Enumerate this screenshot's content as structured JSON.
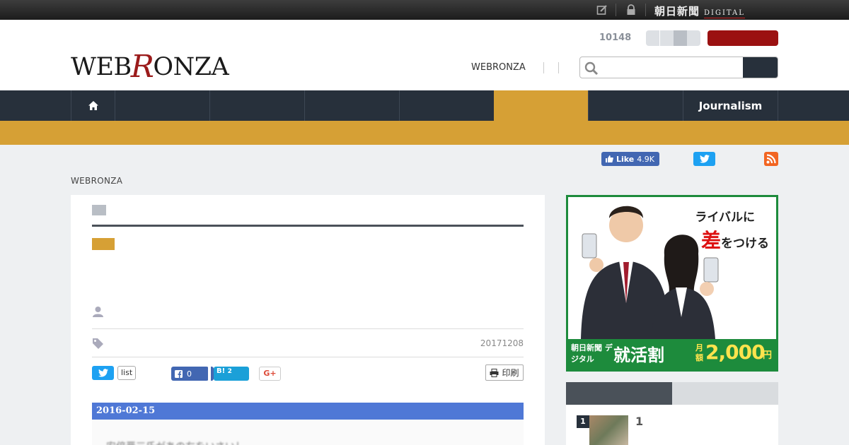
{
  "topbar": {
    "brand_jp": "朝日新聞",
    "brand_en": "DIGITAL",
    "icons": [
      "edit-icon",
      "lock-icon"
    ]
  },
  "header": {
    "logo_pre": "WEB",
    "logo_r": "R",
    "logo_post": "ONZA",
    "count": "10148",
    "link": "WEBRONZA",
    "search": {
      "placeholder": "",
      "value": ""
    }
  },
  "nav": {
    "tabs": [
      {
        "label": "",
        "icon": "home-icon"
      },
      {
        "label": ""
      },
      {
        "label": ""
      },
      {
        "label": ""
      },
      {
        "label": ""
      },
      {
        "label": "",
        "active": true
      },
      {
        "label": ""
      },
      {
        "label": "Journalism"
      }
    ]
  },
  "social": {
    "fb_like_label": "Like",
    "fb_like_count": "4.9K"
  },
  "breadcrumb": "WEBRONZA",
  "article": {
    "date": "20171208",
    "list_label": "list",
    "fb_share_count": "0",
    "hatena_label": "B!",
    "hatena_count": "2",
    "gplus_label": "G+",
    "print_label": "印刷",
    "image_date": "2016-02-15",
    "image_text": "安倍晋三氏があの左をいさいし"
  },
  "ad": {
    "line1": "ライバルに",
    "line2_big": "差",
    "line2_rest": "をつける",
    "brand": "朝日新聞 デジタル",
    "campaign": "就活割",
    "unit": "月額",
    "price": "2,000",
    "currency": "円"
  },
  "ranking": {
    "rank": "1",
    "title": "1"
  },
  "colors": {
    "nav_bg": "#27303b",
    "accent_gold": "#d6a035",
    "brand_red": "#9b1111",
    "facebook": "#4267b2",
    "twitter": "#1da1f2",
    "ad_green": "#1d8b3c"
  }
}
